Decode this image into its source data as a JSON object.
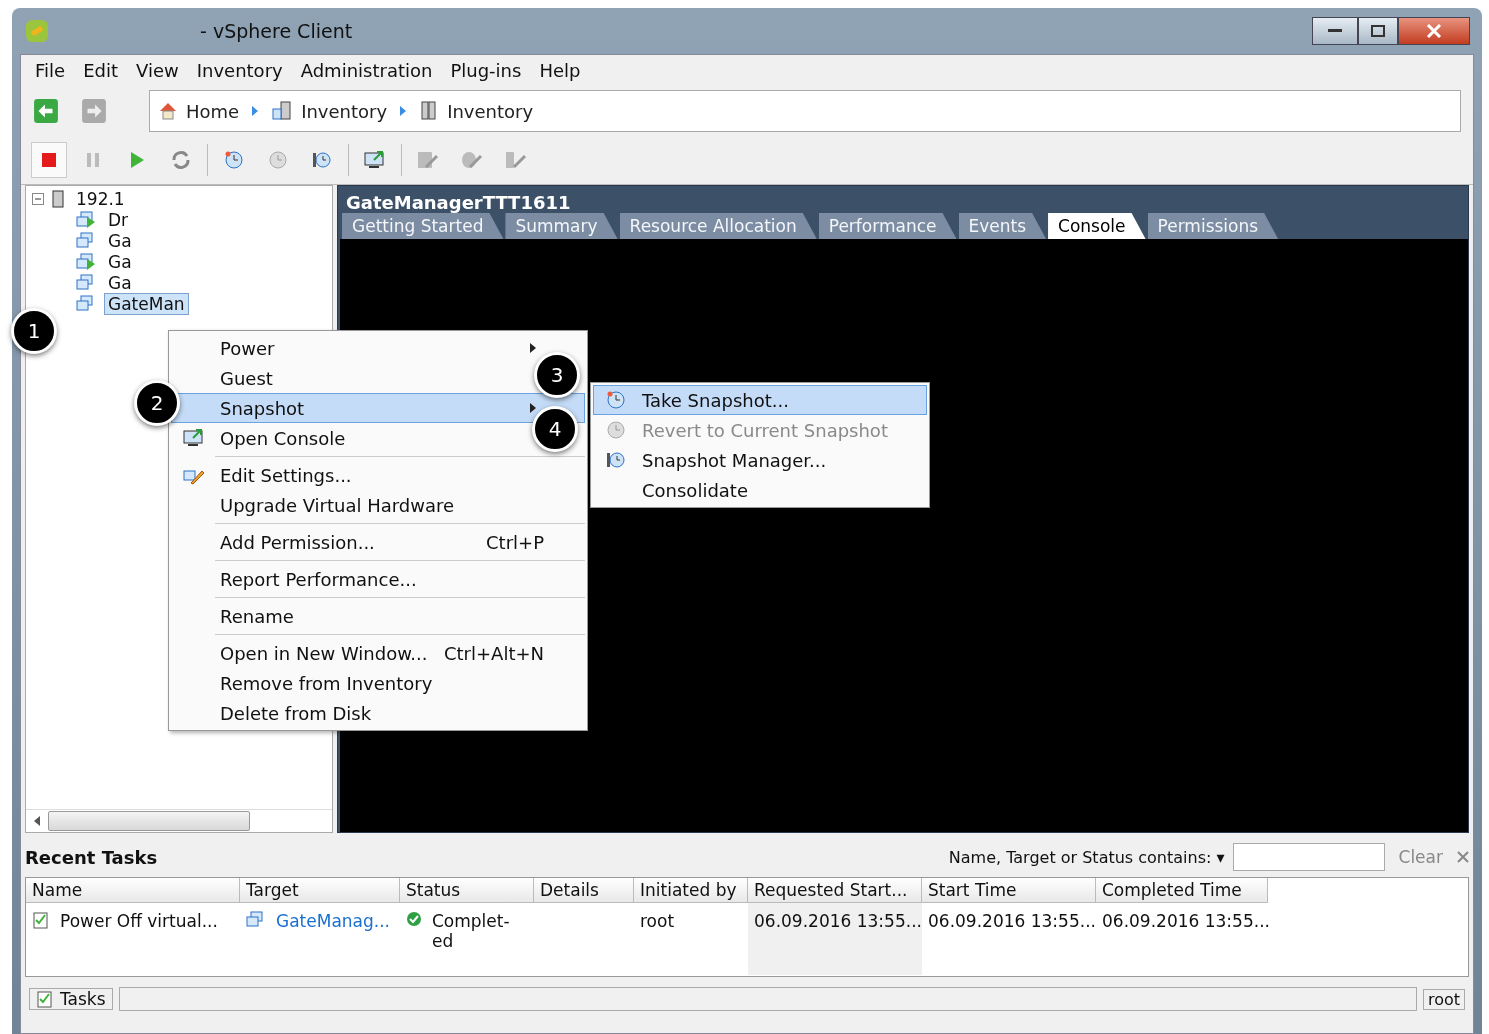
{
  "window": {
    "title": "- vSphere Client"
  },
  "menu_bar": [
    "File",
    "Edit",
    "View",
    "Inventory",
    "Administration",
    "Plug-ins",
    "Help"
  ],
  "breadcrumb": [
    {
      "label": "Home",
      "kind": "home"
    },
    {
      "label": "Inventory",
      "kind": "hosts"
    },
    {
      "label": "Inventory",
      "kind": "host"
    }
  ],
  "tree": {
    "label": "192.1",
    "expanded": true,
    "children": [
      {
        "label": "Dr",
        "powered_on": true,
        "selected": false
      },
      {
        "label": "Ga",
        "powered_on": false,
        "selected": false
      },
      {
        "label": "Ga",
        "powered_on": true,
        "selected": false
      },
      {
        "label": "Ga",
        "powered_on": false,
        "selected": false
      },
      {
        "label": "GateMan",
        "powered_on": false,
        "selected": true
      }
    ]
  },
  "detail": {
    "title": "GateManagerTTT1611",
    "tabs": [
      {
        "label": "Getting Started",
        "selected": false
      },
      {
        "label": "Summary",
        "selected": false
      },
      {
        "label": "Resource Allocation",
        "selected": false
      },
      {
        "label": "Performance",
        "selected": false
      },
      {
        "label": "Events",
        "selected": false
      },
      {
        "label": "Console",
        "selected": true
      },
      {
        "label": "Permissions",
        "selected": false
      }
    ]
  },
  "context_menu": [
    {
      "kind": "item",
      "label": "Power",
      "submenu": true,
      "selected": false
    },
    {
      "kind": "item",
      "label": "Guest",
      "selected": false
    },
    {
      "kind": "item",
      "label": "Snapshot",
      "submenu": true,
      "selected": true
    },
    {
      "kind": "item",
      "label": "Open Console",
      "selected": false
    },
    {
      "kind": "separator"
    },
    {
      "kind": "item",
      "label": "Edit Settings...",
      "selected": false
    },
    {
      "kind": "item",
      "label": "Upgrade Virtual Hardware",
      "selected": false
    },
    {
      "kind": "separator"
    },
    {
      "kind": "item",
      "label": "Add Permission...",
      "shortcut": "Ctrl+P",
      "selected": false
    },
    {
      "kind": "separator"
    },
    {
      "kind": "item",
      "label": "Report Performance...",
      "selected": false
    },
    {
      "kind": "separator"
    },
    {
      "kind": "item",
      "label": "Rename",
      "selected": false
    },
    {
      "kind": "separator"
    },
    {
      "kind": "item",
      "label": "Open in New Window...",
      "shortcut": "Ctrl+Alt+N",
      "selected": false
    },
    {
      "kind": "item",
      "label": "Remove from Inventory",
      "selected": false
    },
    {
      "kind": "item",
      "label": "Delete from Disk",
      "selected": false
    }
  ],
  "snapshot_menu": [
    {
      "label": "Take Snapshot...",
      "selected": true,
      "disabled": false
    },
    {
      "label": "Revert to Current Snapshot",
      "selected": false,
      "disabled": true
    },
    {
      "label": "Snapshot Manager...",
      "selected": false,
      "disabled": false
    },
    {
      "label": "Consolidate",
      "selected": false,
      "disabled": false
    }
  ],
  "callouts": [
    "1",
    "2",
    "3",
    "4"
  ],
  "recent_tasks": {
    "title": "Recent Tasks",
    "filter_label": "Name, Target or Status contains:",
    "filter_caret": "▾",
    "clear": "Clear",
    "columns": [
      "Name",
      "Target",
      "Status",
      "Details",
      "Initiated by",
      "Requested Start...",
      "Start Time",
      "Completed Time"
    ],
    "rows": [
      [
        "Power Off virtual...",
        "GateManag...",
        "Complet-ed",
        "",
        "root",
        "06.09.2016 13:55...",
        "06.09.2016 13:55...",
        "06.09.2016 13:55..."
      ]
    ]
  },
  "status_bar": {
    "tasks": "Tasks",
    "user": "root"
  }
}
